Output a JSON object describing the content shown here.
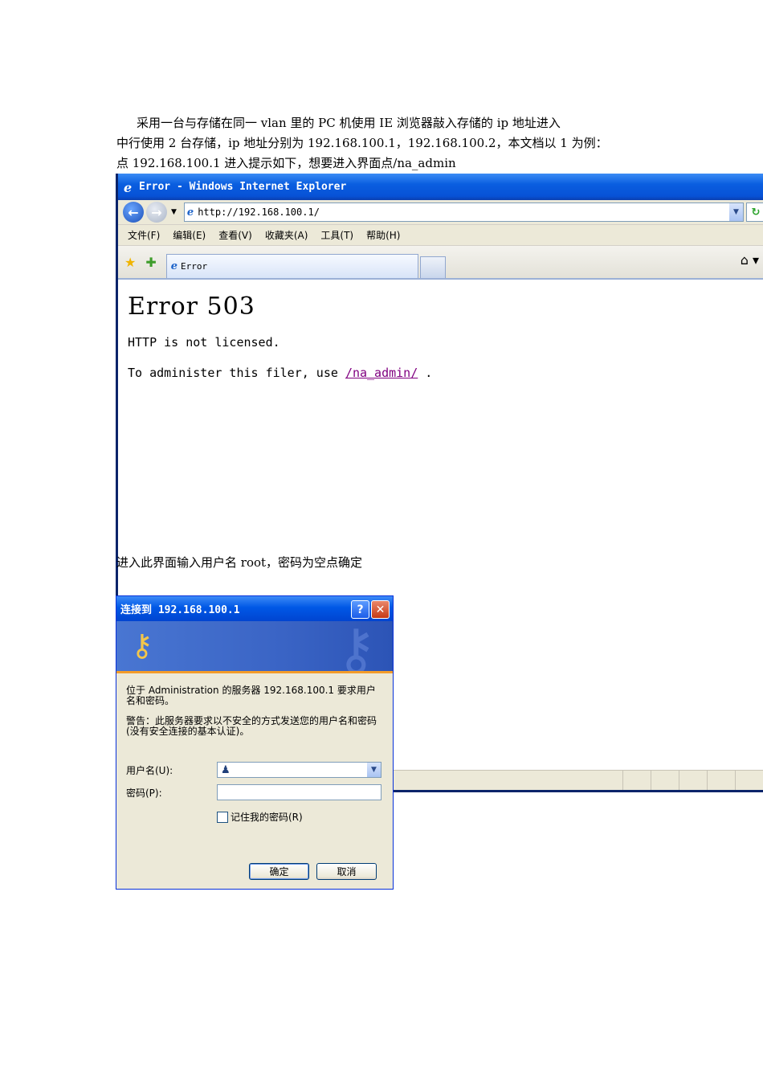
{
  "doc": {
    "para1": "采用一台与存储在同一 vlan 里的 PC 机使用 IE 浏览器敲入存储的 ip 地址进入",
    "para2": "中行使用 2 台存储，ip 地址分别为 192.168.100.1，192.168.100.2，本文档以 1 为例：",
    "para3": "点 192.168.100.1 进入提示如下，想要进入界面点/na_admin",
    "para4": "进入此界面输入用户名 root，密码为空点确定"
  },
  "browser": {
    "title": "Error - Windows Internet Explorer",
    "url": "http://192.168.100.1/",
    "menu": [
      "文件(F)",
      "编辑(E)",
      "查看(V)",
      "收藏夹(A)",
      "工具(T)",
      "帮助(H)"
    ],
    "tab_label": "Error",
    "page": {
      "heading": "Error 503",
      "line1": "HTTP is not licensed.",
      "line2_prefix": "To administer this filer, use",
      "link": "/na_admin/",
      "line2_suffix": "."
    }
  },
  "dialog": {
    "title": "连接到 192.168.100.1",
    "message1": "位于 Administration 的服务器 192.168.100.1 要求用户名和密码。",
    "message2": "警告：此服务器要求以不安全的方式发送您的用户名和密码(没有安全连接的基本认证)。",
    "username_label": "用户名(U):",
    "password_label": "密码(P):",
    "remember_label": "记住我的密码(R)",
    "ok_label": "确定",
    "cancel_label": "取消"
  },
  "colors": {
    "titlebar_blue": "#0a5ee0",
    "link_visited": "#800080",
    "xp_face": "#ece9d8"
  }
}
